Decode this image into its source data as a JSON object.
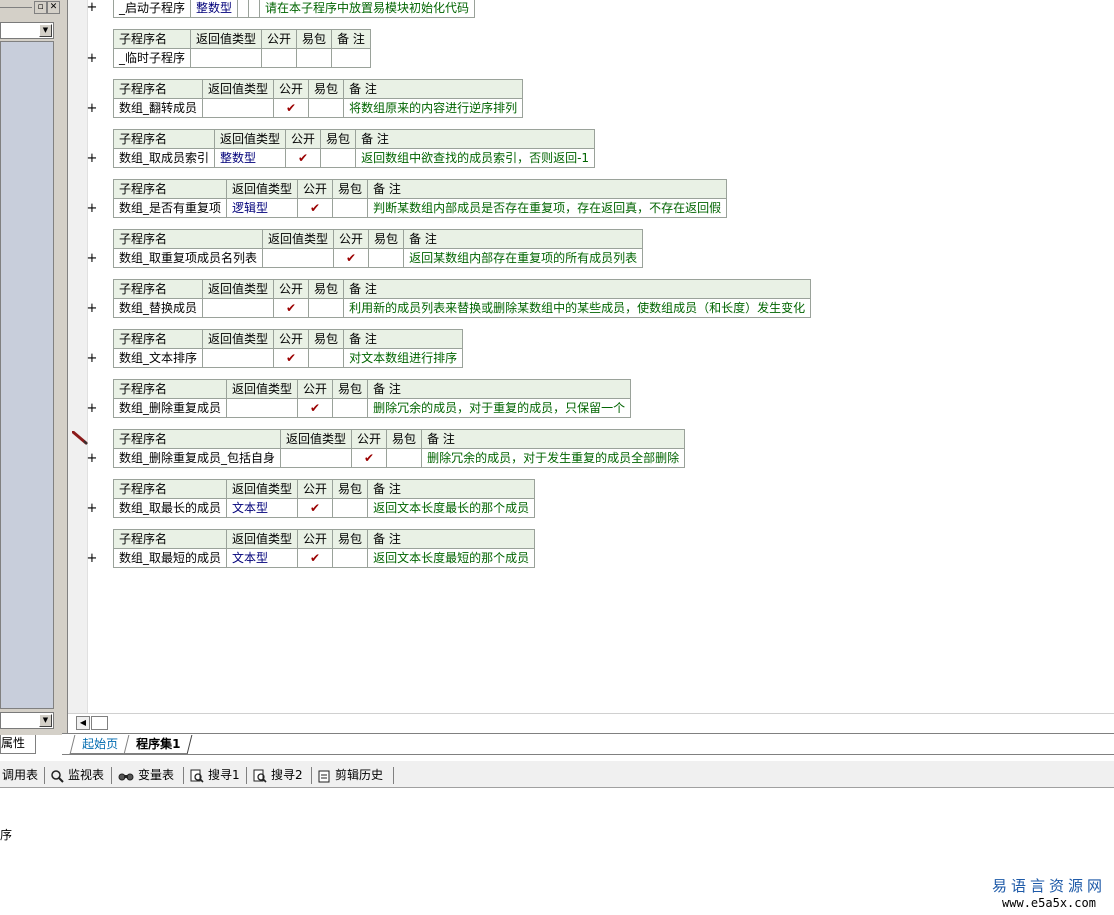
{
  "columns": {
    "name": "子程序名",
    "return_type": "返回值类型",
    "public": "公开",
    "easy_pack": "易包",
    "remark": "备 注"
  },
  "check_mark": "✔",
  "subroutines": [
    {
      "name": "_启动子程序",
      "return_type": "整数型",
      "public": "",
      "remark": "请在本子程序中放置易模块初始化代码",
      "has_header": false
    },
    {
      "name": "_临时子程序",
      "return_type": "",
      "public": "",
      "remark": "",
      "has_header": true
    },
    {
      "name": "数组_翻转成员",
      "return_type": "",
      "public": "✔",
      "remark": "将数组原来的内容进行逆序排列",
      "has_header": true
    },
    {
      "name": "数组_取成员索引",
      "return_type": "整数型",
      "public": "✔",
      "remark": "返回数组中欲查找的成员索引，否则返回-1",
      "has_header": true
    },
    {
      "name": "数组_是否有重复项",
      "return_type": "逻辑型",
      "public": "✔",
      "remark": "判断某数组内部成员是否存在重复项，存在返回真，不存在返回假",
      "has_header": true
    },
    {
      "name": "数组_取重复项成员名列表",
      "return_type": "",
      "public": "✔",
      "remark": "返回某数组内部存在重复项的所有成员列表",
      "has_header": true
    },
    {
      "name": "数组_替换成员",
      "return_type": "",
      "public": "✔",
      "remark": "利用新的成员列表来替换或删除某数组中的某些成员，使数组成员（和长度）发生变化",
      "has_header": true
    },
    {
      "name": "数组_文本排序",
      "return_type": "",
      "public": "✔",
      "remark": "对文本数组进行排序",
      "has_header": true
    },
    {
      "name": "数组_删除重复成员",
      "return_type": "",
      "public": "✔",
      "remark": "删除冗余的成员，对于重复的成员，只保留一个",
      "has_header": true
    },
    {
      "name": "数组_删除重复成员_包括自身",
      "return_type": "",
      "public": "✔",
      "remark": "删除冗余的成员，对于发生重复的成员全部删除",
      "has_header": true
    },
    {
      "name": "数组_取最长的成员",
      "return_type": "文本型",
      "public": "✔",
      "remark": "返回文本长度最长的那个成员",
      "has_header": true
    },
    {
      "name": "数组_取最短的成员",
      "return_type": "文本型",
      "public": "✔",
      "remark": "返回文本长度最短的那个成员",
      "has_header": true
    }
  ],
  "expand_symbol": "+",
  "left_panel": {
    "property_tab": "属性",
    "close_glyph": "✕",
    "restore_glyph": "▫",
    "dropdown_glyph": "▼"
  },
  "tabs": {
    "start_page": "起始页",
    "program_set": "程序集1"
  },
  "toolbar": {
    "call_table": "调用表",
    "watch_table": "监视表",
    "variable_table": "变量表",
    "search1": "搜寻1",
    "search2": "搜寻2",
    "clip_history": "剪辑历史"
  },
  "output": {
    "line": "序"
  },
  "watermark": {
    "title": "易语言资源网",
    "url": "www.e5a5x.com"
  },
  "colors": {
    "header_bg": "#e9f1e5",
    "type_text": "#00007a",
    "remark_text": "#006400",
    "check": "#9a0000"
  }
}
